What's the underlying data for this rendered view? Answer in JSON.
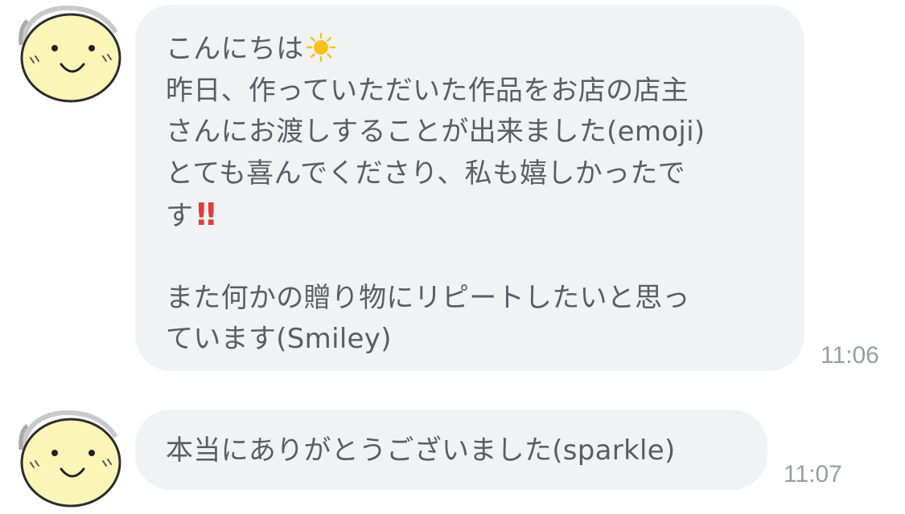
{
  "colors": {
    "bubble": "#f1f2f4",
    "text": "#5a5d63",
    "timestamp": "#9a9da3",
    "avatar_face": "#fbf6b7",
    "sun": "#f6c21a",
    "exclamation": "#e23d39"
  },
  "messages": [
    {
      "avatar_icon": "smiley-face-avatar-icon",
      "lines": {
        "l1": "こんにちは",
        "l1_icon": "sun-emoji-icon",
        "l2": "昨日、作っていただいた作品をお店の店主",
        "l3": "さんにお渡しすることが出来ました(emoji)",
        "l4": "とても喜んでくださり、私も嬉しかったで",
        "l5": "す",
        "l5_mark": "‼",
        "l6": "また何かの贈り物にリピートしたいと思っ",
        "l7": "ています(Smiley)"
      },
      "time": "11:06"
    },
    {
      "avatar_icon": "smiley-face-avatar-icon",
      "lines": {
        "l1": "本当にありがとうございました(sparkle)"
      },
      "time": "11:07"
    }
  ]
}
